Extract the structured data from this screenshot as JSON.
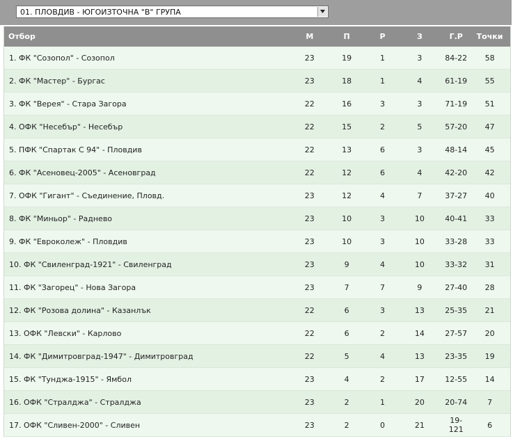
{
  "selector": {
    "value": "01. ПЛОВДИВ - ЮГОИЗТОЧНА \"В\" ГРУПА",
    "arrow_icon": "dropdown-arrow-icon"
  },
  "table": {
    "headers": {
      "team": "Отбор",
      "m": "М",
      "p": "П",
      "r": "Р",
      "z": "З",
      "gr": "Г.Р",
      "pts": "Точки"
    },
    "rows": [
      {
        "team": "1. ФК \"Созопол\" - Созопол",
        "m": "23",
        "p": "19",
        "r": "1",
        "z": "3",
        "gr": "84-22",
        "pts": "58"
      },
      {
        "team": "2. ФК \"Мастер\" - Бургас",
        "m": "23",
        "p": "18",
        "r": "1",
        "z": "4",
        "gr": "61-19",
        "pts": "55"
      },
      {
        "team": "3. ФК \"Верея\" - Стара Загора",
        "m": "22",
        "p": "16",
        "r": "3",
        "z": "3",
        "gr": "71-19",
        "pts": "51"
      },
      {
        "team": "4. ОФК \"Несебър\" - Несебър",
        "m": "22",
        "p": "15",
        "r": "2",
        "z": "5",
        "gr": "57-20",
        "pts": "47"
      },
      {
        "team": "5. ПФК \"Спартак С 94\" - Пловдив",
        "m": "22",
        "p": "13",
        "r": "6",
        "z": "3",
        "gr": "48-14",
        "pts": "45"
      },
      {
        "team": "6. ФК \"Асеновец-2005\" - Асеновград",
        "m": "22",
        "p": "12",
        "r": "6",
        "z": "4",
        "gr": "42-20",
        "pts": "42"
      },
      {
        "team": "7. ОФК \"Гигант\" - Съединение, Пловд.",
        "m": "23",
        "p": "12",
        "r": "4",
        "z": "7",
        "gr": "37-27",
        "pts": "40"
      },
      {
        "team": "8. ФК \"Миньор\" - Раднево",
        "m": "23",
        "p": "10",
        "r": "3",
        "z": "10",
        "gr": "40-41",
        "pts": "33"
      },
      {
        "team": "9. ФК \"Евроколеж\" - Пловдив",
        "m": "23",
        "p": "10",
        "r": "3",
        "z": "10",
        "gr": "33-28",
        "pts": "33"
      },
      {
        "team": "10. ФК \"Свиленград-1921\" - Свиленград",
        "m": "23",
        "p": "9",
        "r": "4",
        "z": "10",
        "gr": "33-32",
        "pts": "31"
      },
      {
        "team": "11. ФК \"Загорец\" - Нова Загора",
        "m": "23",
        "p": "7",
        "r": "7",
        "z": "9",
        "gr": "27-40",
        "pts": "28"
      },
      {
        "team": "12. ФК \"Розова долина\" - Казанлък",
        "m": "22",
        "p": "6",
        "r": "3",
        "z": "13",
        "gr": "25-35",
        "pts": "21"
      },
      {
        "team": "13. ОФК \"Левски\" - Карлово",
        "m": "22",
        "p": "6",
        "r": "2",
        "z": "14",
        "gr": "27-57",
        "pts": "20"
      },
      {
        "team": "14. ФК \"Димитровград-1947\" - Димитровград",
        "m": "22",
        "p": "5",
        "r": "4",
        "z": "13",
        "gr": "23-35",
        "pts": "19"
      },
      {
        "team": "15. ФК \"Тунджа-1915\" - Ямбол",
        "m": "23",
        "p": "4",
        "r": "2",
        "z": "17",
        "gr": "12-55",
        "pts": "14"
      },
      {
        "team": "16. ОФК \"Стралджа\" - Стралджа",
        "m": "23",
        "p": "2",
        "r": "1",
        "z": "20",
        "gr": "20-74",
        "pts": "7"
      },
      {
        "team": "17. ОФК \"Сливен-2000\" - Сливен",
        "m": "23",
        "p": "2",
        "r": "0",
        "z": "21",
        "gr": "19-121",
        "pts": "6"
      }
    ]
  }
}
